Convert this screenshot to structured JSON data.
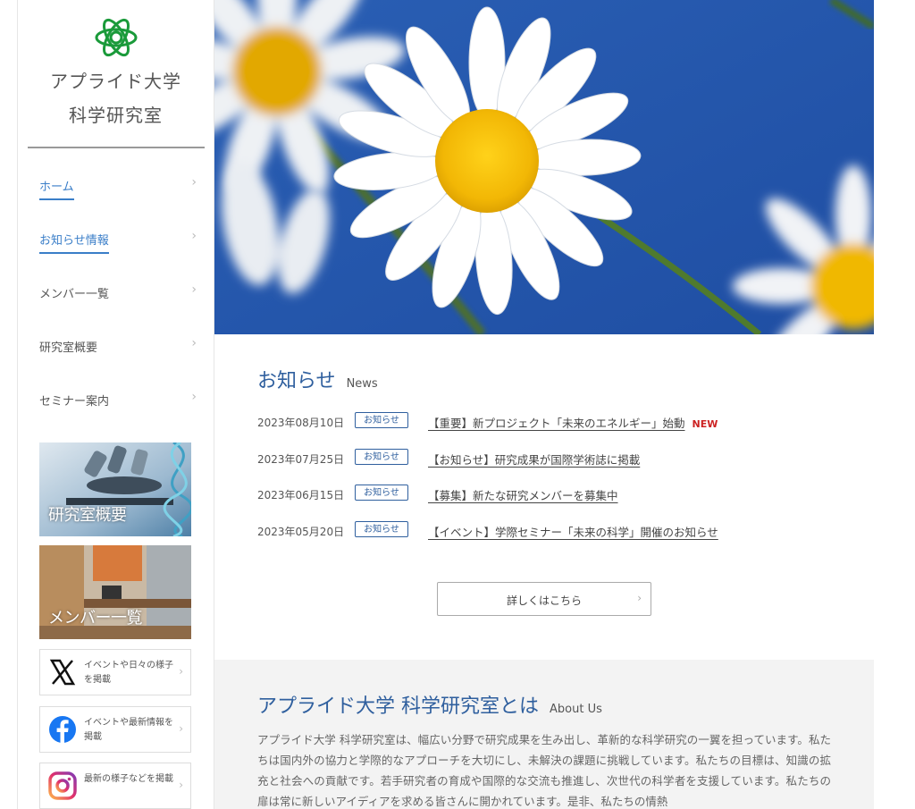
{
  "sidebar": {
    "logo_line1": "アプライド大学",
    "logo_line2": "科学研究室",
    "logo_icon": "atom-icon",
    "nav": [
      {
        "label": "ホーム",
        "active": true
      },
      {
        "label": "お知らせ情報",
        "active": true
      },
      {
        "label": "メンバー一覧",
        "active": false
      },
      {
        "label": "研究室概要",
        "active": false
      },
      {
        "label": "セミナー案内",
        "active": false
      }
    ],
    "banners": [
      {
        "label": "研究室概要"
      },
      {
        "label": "メンバー一覧"
      }
    ],
    "sns": [
      {
        "icon": "x-logo-icon",
        "text": "イベントや日々の様子を掲載"
      },
      {
        "icon": "facebook-icon",
        "text": "イベントや最新情報を掲載"
      },
      {
        "icon": "instagram-icon",
        "text": "最新の様子などを掲載"
      }
    ]
  },
  "news": {
    "title": "お知らせ",
    "subtitle": "News",
    "items": [
      {
        "date": "2023年08月10日",
        "tag": "お知らせ",
        "title": "【重要】新プロジェクト「未来のエネルギー」始動",
        "badge": "NEW"
      },
      {
        "date": "2023年07月25日",
        "tag": "お知らせ",
        "title": "【お知らせ】研究成果が国際学術誌に掲載",
        "badge": ""
      },
      {
        "date": "2023年06月15日",
        "tag": "お知らせ",
        "title": "【募集】新たな研究メンバーを募集中",
        "badge": ""
      },
      {
        "date": "2023年05月20日",
        "tag": "お知らせ",
        "title": "【イベント】学際セミナー「未来の科学」開催のお知らせ",
        "badge": ""
      }
    ],
    "more_label": "詳しくはこちら"
  },
  "about": {
    "title": "アプライド大学 科学研究室とは",
    "subtitle": "About Us",
    "body": "アプライド大学 科学研究室は、幅広い分野で研究成果を生み出し、革新的な科学研究の一翼を担っています。私たちは国内外の協力と学際的なアプローチを大切にし、未解決の課題に挑戦しています。私たちの目標は、知識の拡充と社会への貢献です。若手研究者の育成や国際的な交流も推進し、次世代の科学者を支援しています。私たちの扉は常に新しいアイディアを求める皆さんに開かれています。是非、私たちの情熱"
  },
  "colors": {
    "accent": "#2f5f9e",
    "nav_active": "#3a7ec8",
    "new_badge": "#cc2222",
    "about_bg": "#f3f3f3",
    "logo_green": "#1a9a3a"
  }
}
